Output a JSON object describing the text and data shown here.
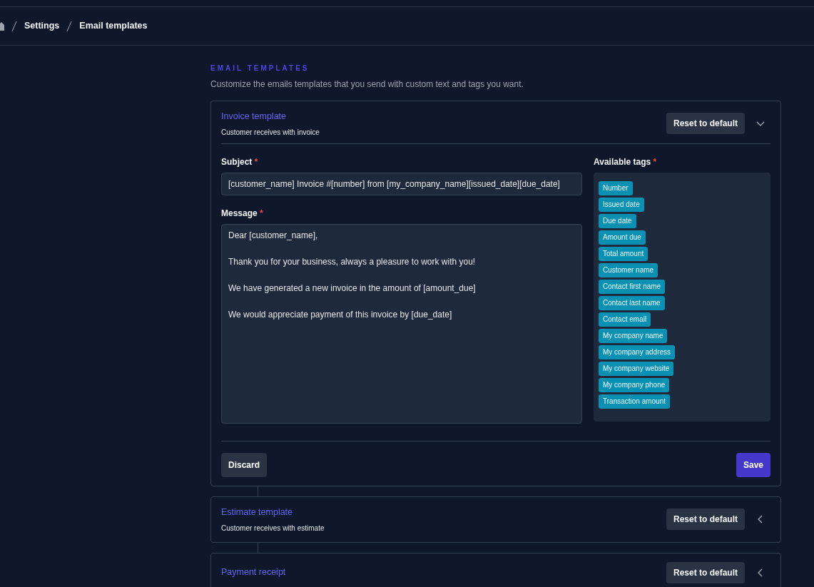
{
  "breadcrumb": [
    {
      "label": "Settings"
    },
    {
      "label": "Email templates"
    }
  ],
  "section": {
    "heading": "EMAIL TEMPLATES",
    "description": "Customize the emails templates that you send with custom text and tags you want."
  },
  "templates": [
    {
      "title": "Invoice template",
      "subtitle": "Customer receives with invoice",
      "reset_label": "Reset to default",
      "expanded": true,
      "form": {
        "subject": {
          "label": "Subject",
          "required_mark": "*",
          "value": "[customer_name] Invoice #[number] from [my_company_name][issued_date][due_date]"
        },
        "message": {
          "label": "Message",
          "required_mark": "*",
          "value": "Dear [customer_name],\n\nThank you for your business, always a pleasure to work with you!\n\nWe have generated a new invoice in the amount of [amount_due]\n\nWe would appreciate payment of this invoice by [due_date]"
        },
        "tags": {
          "label": "Available tags",
          "required_mark": "*",
          "items": [
            "Number",
            "Issued date",
            "Due date",
            "Amount due",
            "Total amount",
            "Customer name",
            "Contact first name",
            "Contact last name",
            "Contact email",
            "My company name",
            "My company address",
            "My company website",
            "My company phone",
            "Transaction amount"
          ]
        },
        "discard_label": "Discard",
        "save_label": "Save"
      }
    },
    {
      "title": "Estimate template",
      "subtitle": "Customer receives with estimate",
      "reset_label": "Reset to default",
      "expanded": false
    },
    {
      "title": "Payment receipt",
      "reset_label": "Reset to default",
      "expanded": false
    }
  ]
}
